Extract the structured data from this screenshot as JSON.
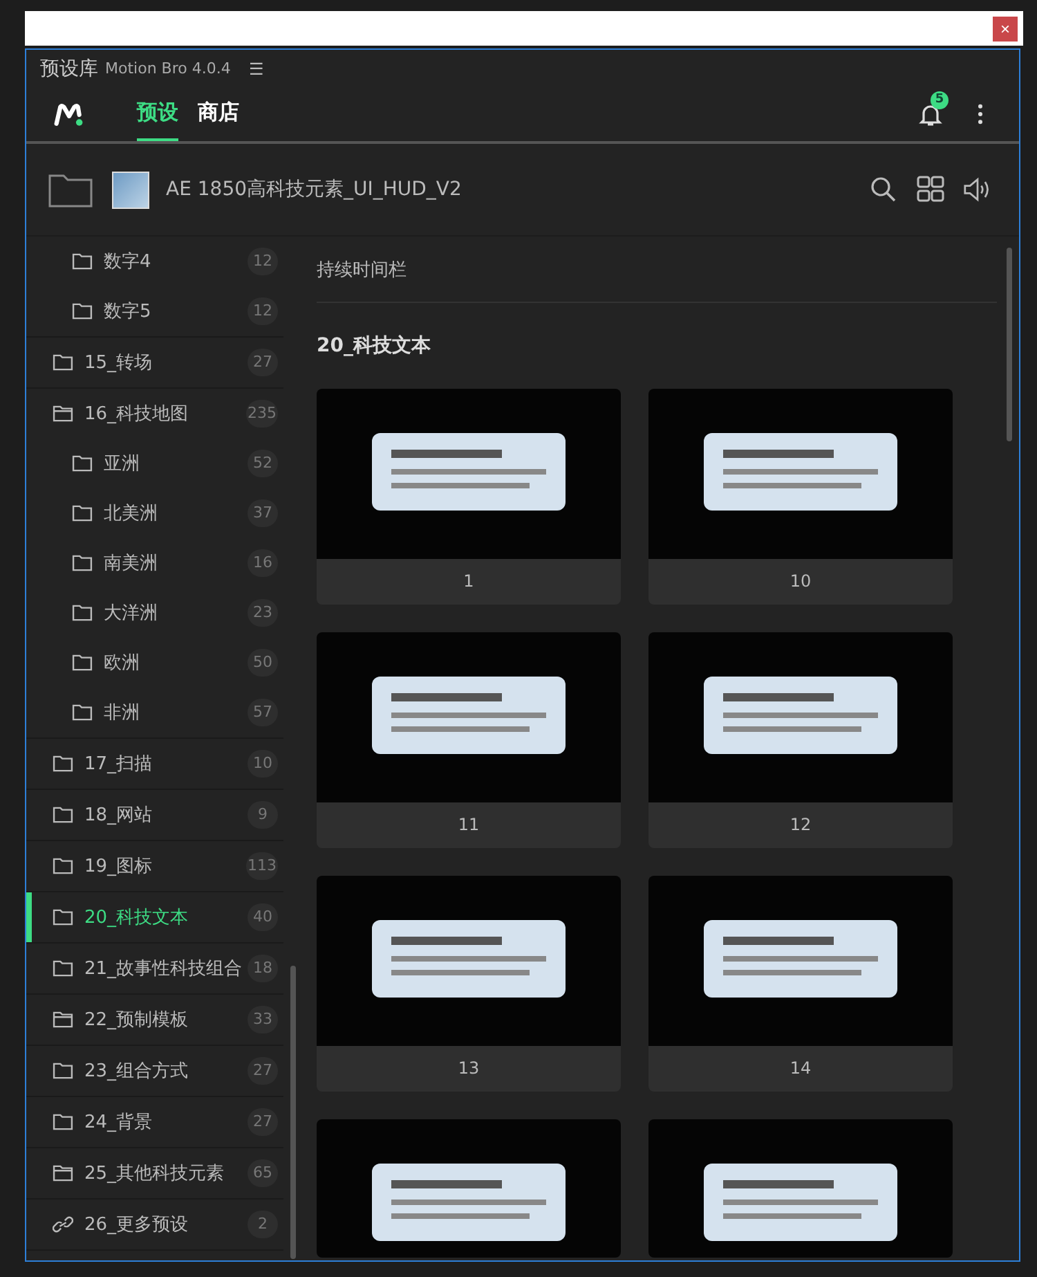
{
  "window": {
    "close_label": "×"
  },
  "panel": {
    "title": "预设库",
    "version": "Motion Bro 4.0.4",
    "menu_glyph": "☰"
  },
  "nav": {
    "tabs": [
      {
        "label": "预设",
        "selected": true
      },
      {
        "label": "商店",
        "selected": false
      }
    ],
    "notification_count": "5"
  },
  "pack": {
    "title": "AE 1850高科技元素_UI_HUD_V2"
  },
  "sidebar": {
    "items": [
      {
        "children": [
          {
            "label": "数字4",
            "count": "12",
            "kind": "folder",
            "selected": false
          },
          {
            "label": "数字5",
            "count": "12",
            "kind": "folder",
            "selected": false
          }
        ]
      },
      {
        "label": "15_转场",
        "count": "27",
        "kind": "folder",
        "selected": false
      },
      {
        "label": "16_科技地图",
        "count": "235",
        "kind": "folder-open",
        "selected": false,
        "children": [
          {
            "label": "亚洲",
            "count": "52",
            "kind": "folder",
            "selected": false
          },
          {
            "label": "北美洲",
            "count": "37",
            "kind": "folder",
            "selected": false
          },
          {
            "label": "南美洲",
            "count": "16",
            "kind": "folder",
            "selected": false
          },
          {
            "label": "大洋洲",
            "count": "23",
            "kind": "folder",
            "selected": false
          },
          {
            "label": "欧洲",
            "count": "50",
            "kind": "folder",
            "selected": false
          },
          {
            "label": "非洲",
            "count": "57",
            "kind": "folder",
            "selected": false
          }
        ]
      },
      {
        "label": "17_扫描",
        "count": "10",
        "kind": "folder",
        "selected": false
      },
      {
        "label": "18_网站",
        "count": "9",
        "kind": "folder",
        "selected": false
      },
      {
        "label": "19_图标",
        "count": "113",
        "kind": "folder",
        "selected": false
      },
      {
        "label": "20_科技文本",
        "count": "40",
        "kind": "folder",
        "selected": true
      },
      {
        "label": "21_故事性科技组合",
        "count": "18",
        "kind": "folder",
        "selected": false
      },
      {
        "label": "22_预制模板",
        "count": "33",
        "kind": "folder-open",
        "selected": false
      },
      {
        "label": "23_组合方式",
        "count": "27",
        "kind": "folder",
        "selected": false
      },
      {
        "label": "24_背景",
        "count": "27",
        "kind": "folder",
        "selected": false
      },
      {
        "label": "25_其他科技元素",
        "count": "65",
        "kind": "folder-open",
        "selected": false
      },
      {
        "label": "26_更多预设",
        "count": "2",
        "kind": "link",
        "selected": false
      }
    ]
  },
  "content": {
    "duration_bar_label": "持续时间栏",
    "section_title": "20_科技文本",
    "presets": [
      {
        "label": "1",
        "clipped": false
      },
      {
        "label": "10",
        "clipped": false
      },
      {
        "label": "11",
        "clipped": false
      },
      {
        "label": "12",
        "clipped": false
      },
      {
        "label": "13",
        "clipped": false
      },
      {
        "label": "14",
        "clipped": false
      },
      {
        "clipped": true
      },
      {
        "clipped": true
      }
    ]
  }
}
